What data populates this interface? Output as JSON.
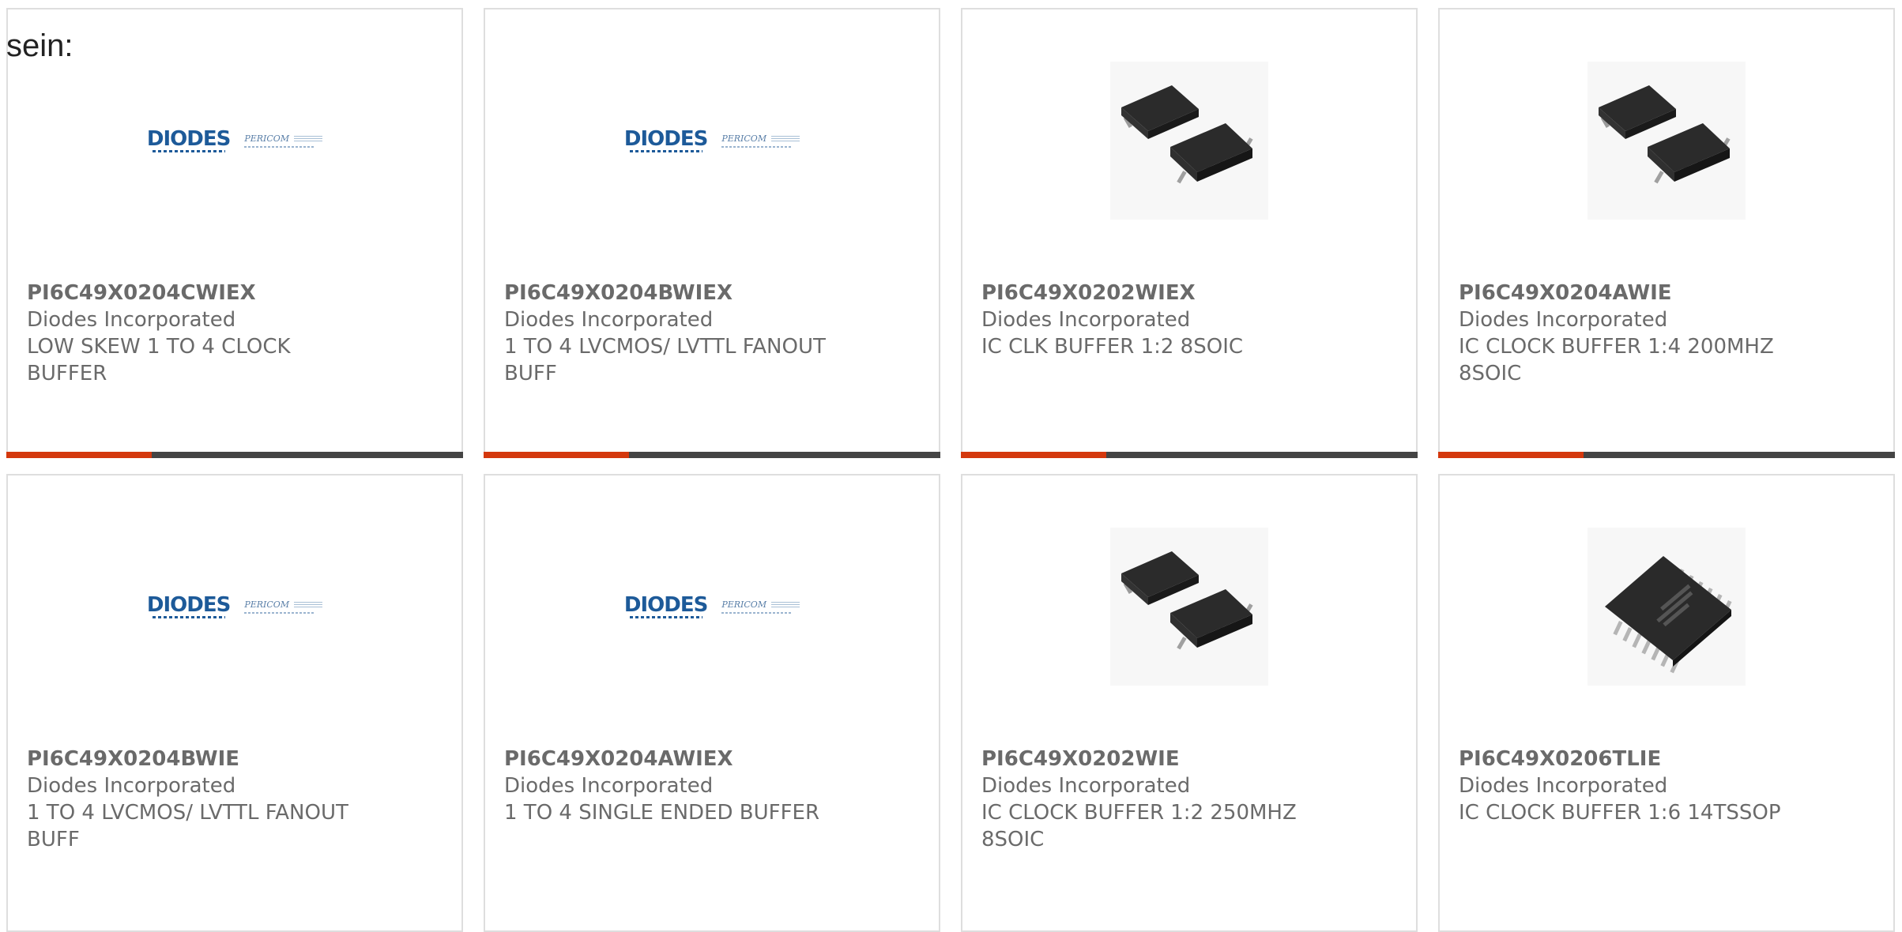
{
  "intro_text": "sein:",
  "colors": {
    "accent": "#d4380d",
    "bar": "#444444",
    "text": "#6a6a6a",
    "border": "#dedede"
  },
  "products": [
    {
      "part_number": "PI6C49X0204CWIEX",
      "manufacturer": "Diodes Incorporated",
      "description": "LOW SKEW 1 TO 4 CLOCK BUFFER",
      "image": "diodes-pericom-logo",
      "logo_text": "DIODES",
      "logo_sub_text": "PERICOM"
    },
    {
      "part_number": "PI6C49X0204BWIEX",
      "manufacturer": "Diodes Incorporated",
      "description": "1 TO 4 LVCMOS/ LVTTL FANOUT BUFF",
      "image": "diodes-pericom-logo",
      "logo_text": "DIODES",
      "logo_sub_text": "PERICOM"
    },
    {
      "part_number": "PI6C49X0202WIEX",
      "manufacturer": "Diodes Incorporated",
      "description": "IC CLK BUFFER 1:2 8SOIC",
      "image": "soic8-chip-photo"
    },
    {
      "part_number": "PI6C49X0204AWIE",
      "manufacturer": "Diodes Incorporated",
      "description": "IC CLOCK BUFFER 1:4 200MHZ 8SOIC",
      "image": "soic8-chip-photo"
    },
    {
      "part_number": "PI6C49X0204BWIE",
      "manufacturer": "Diodes Incorporated",
      "description": "1 TO 4 LVCMOS/ LVTTL FANOUT BUFF",
      "image": "diodes-pericom-logo",
      "logo_text": "DIODES",
      "logo_sub_text": "PERICOM"
    },
    {
      "part_number": "PI6C49X0204AWIEX",
      "manufacturer": "Diodes Incorporated",
      "description": "1 TO 4 SINGLE ENDED BUFFER",
      "image": "diodes-pericom-logo",
      "logo_text": "DIODES",
      "logo_sub_text": "PERICOM"
    },
    {
      "part_number": "PI6C49X0202WIE",
      "manufacturer": "Diodes Incorporated",
      "description": "IC CLOCK BUFFER 1:2 250MHZ 8SOIC",
      "image": "soic8-chip-photo"
    },
    {
      "part_number": "PI6C49X0206TLIE",
      "manufacturer": "Diodes Incorporated",
      "description": "IC CLOCK BUFFER 1:6 14TSSOP",
      "image": "tssop14-chip-photo"
    }
  ]
}
